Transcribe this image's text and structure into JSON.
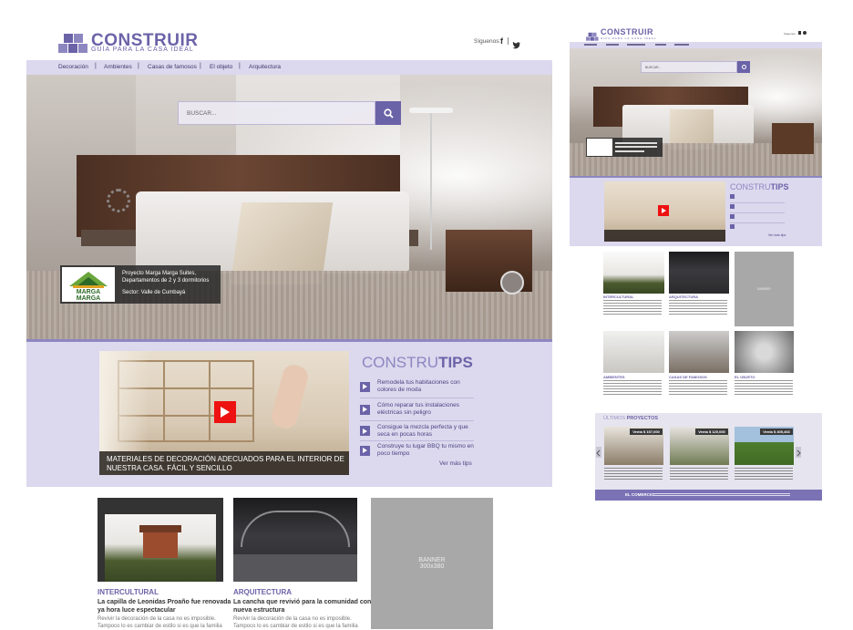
{
  "desktop": {
    "brand": {
      "title": "CONSTRUIR",
      "subtitle": "GUÍA PARA LA CASA IDEAL"
    },
    "social": {
      "label": "Síguenos:",
      "facebook": "f",
      "twitter": "t"
    },
    "nav": [
      "Decoración",
      "Ambientes",
      "Casas de famosos",
      "El objeto",
      "Arquitectura"
    ],
    "search": {
      "placeholder": "BUSCAR..."
    },
    "hero_caption": {
      "logo_text": "MARGA MARGA",
      "line1": "Proyecto Marga Marga Suites,",
      "line2": "Departamentos de 2 y 3 dormitorios",
      "line3": "Sector: Valle de Cumbayá"
    },
    "tips": {
      "title_light": "CONSTRU",
      "title_bold": "TIPS",
      "video_caption_1": "MATERIALES DE DECORACIÓN ADECUADOS PARA EL INTERIOR DE",
      "video_caption_2": "NUESTRA CASA. FÁCIL Y SENCILLO",
      "items": [
        {
          "l1": "Remodela tus habitaciones con",
          "l2": "colores de moda"
        },
        {
          "l1": "Cómo reparar tus instalaciones",
          "l2": "eléctricas sin peligro"
        },
        {
          "l1": "Consigue la mezcla perfecta y que",
          "l2": "seca en pocas horas"
        },
        {
          "l1": "Construye tu lugar BBQ tu mismo en",
          "l2": "poco tiempo"
        }
      ],
      "more": "Ver más tips"
    },
    "cards": [
      {
        "category": "INTERCULTURAL",
        "head1": "La capilla de Leonidas Proaño fue renovada",
        "head2": "ya hora luce espectacular",
        "body1": "Revivir la decoración de la casa no es imposible.",
        "body2": "Tampoco lo es cambiar de estilo si es que la familia"
      },
      {
        "category": "ARQUITECTURA",
        "head1": "La cancha que revivió para la comunidad con",
        "head2": "nueva estructura",
        "body1": "Revivir la decoración de la casa no es imposible.",
        "body2": "Tampoco lo es cambiar de estilo si es que la familia"
      }
    ],
    "banner": {
      "line1": "BANNER",
      "line2": "300x380"
    }
  },
  "mobile": {
    "brand": {
      "title": "CONSTRUIR",
      "subtitle": "GUÍA PARA LA CASA IDEAL"
    },
    "social_label": "Síguenos:",
    "search_placeholder": "BUSCAR...",
    "tips_light": "CONSTRU",
    "tips_bold": "TIPS",
    "more": "Ver más tips",
    "cards": [
      {
        "category": "INTERCULTURAL"
      },
      {
        "category": "ARQUITECTURA"
      },
      {
        "category": "AMBIENTES"
      },
      {
        "category": "CASAS DE FAMOSOS"
      },
      {
        "category": "EL OBJETO"
      }
    ],
    "banner": "BANNER",
    "projects_light": "ÚLTIMOS",
    "projects_bold": "PROYECTOS",
    "prices": [
      "Venta $ 157,000",
      "Venta $ 120,000",
      "Venta $ 405,463"
    ],
    "footer_brand": "EL COMERCIO"
  },
  "colors": {
    "accent": "#6b63a8",
    "nav_bg": "#dcd8ee",
    "banner": "#a8a8a8"
  }
}
